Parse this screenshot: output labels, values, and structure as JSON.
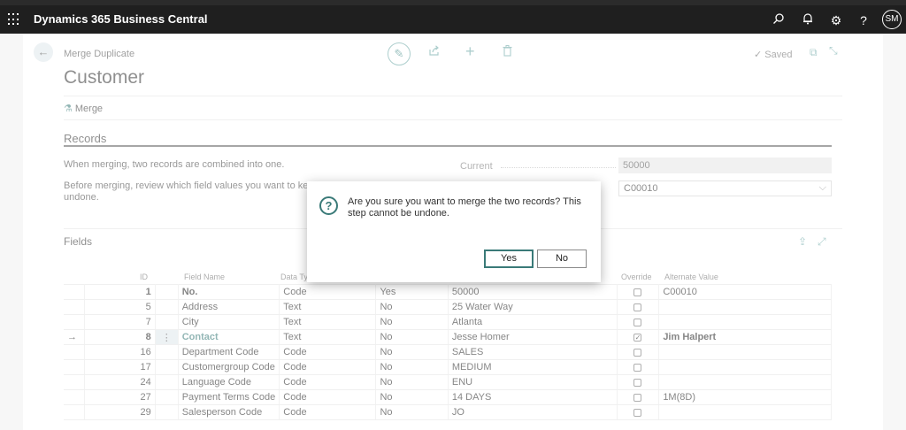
{
  "app": {
    "title": "Dynamics 365 Business Central",
    "user_initials": "SM"
  },
  "header": {
    "breadcrumb": "Merge Duplicate",
    "title": "Customer",
    "saved_label": "Saved"
  },
  "actions": {
    "merge_label": "Merge"
  },
  "records": {
    "title": "Records",
    "desc1": "When merging, two records are combined into one.",
    "desc2a": "Before merging, review which field values you want to keep or ove",
    "desc2b": "undone.",
    "current_label": "Current",
    "current_value": "50000",
    "merge_with_value": "C00010"
  },
  "fields": {
    "title": "Fields",
    "columns": {
      "id": "ID",
      "field_name": "Field Name",
      "data_type": "Data Ty",
      "override": "Override",
      "alternate": "Alternate Value"
    },
    "rows": [
      {
        "id": "1",
        "name": "No.",
        "type": "Code",
        "in_pk": "Yes",
        "current": "50000",
        "override": false,
        "alt": "C00010",
        "bold": true
      },
      {
        "id": "5",
        "name": "Address",
        "type": "Text",
        "in_pk": "No",
        "current": "25 Water Way",
        "override": false,
        "alt": ""
      },
      {
        "id": "7",
        "name": "City",
        "type": "Text",
        "in_pk": "No",
        "current": "Atlanta",
        "override": false,
        "alt": ""
      },
      {
        "id": "8",
        "name": "Contact",
        "type": "Text",
        "in_pk": "No",
        "current": "Jesse Homer",
        "override": true,
        "alt": "Jim Halpert",
        "selected": true
      },
      {
        "id": "16",
        "name": "Department Code",
        "type": "Code",
        "in_pk": "No",
        "current": "SALES",
        "override": false,
        "alt": ""
      },
      {
        "id": "17",
        "name": "Customergroup Code",
        "type": "Code",
        "in_pk": "No",
        "current": "MEDIUM",
        "override": false,
        "alt": ""
      },
      {
        "id": "24",
        "name": "Language Code",
        "type": "Code",
        "in_pk": "No",
        "current": "ENU",
        "override": false,
        "alt": ""
      },
      {
        "id": "27",
        "name": "Payment Terms Code",
        "type": "Code",
        "in_pk": "No",
        "current": "14 DAYS",
        "override": false,
        "alt": "1M(8D)"
      },
      {
        "id": "29",
        "name": "Salesperson Code",
        "type": "Code",
        "in_pk": "No",
        "current": "JO",
        "override": false,
        "alt": ""
      }
    ]
  },
  "dialog": {
    "message": "Are you sure you want to merge the two records? This step cannot be undone.",
    "yes_label": "Yes",
    "no_label": "No"
  },
  "colors": {
    "accent": "#3a7a78",
    "topbar": "#1f1f1f"
  }
}
